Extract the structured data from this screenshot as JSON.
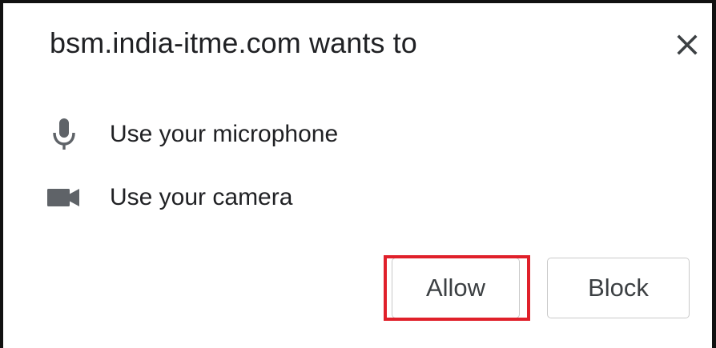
{
  "dialog": {
    "title": "bsm.india-itme.com wants to",
    "close_icon": "close-icon"
  },
  "permissions": [
    {
      "icon": "microphone-icon",
      "label": "Use your microphone"
    },
    {
      "icon": "video-camera-icon",
      "label": "Use your camera"
    }
  ],
  "buttons": {
    "allow_label": "Allow",
    "block_label": "Block"
  },
  "colors": {
    "text": "#202124",
    "icon": "#5f6368",
    "button_border": "#c9c9c9",
    "highlight": "#e0202a",
    "frame": "#111111"
  }
}
